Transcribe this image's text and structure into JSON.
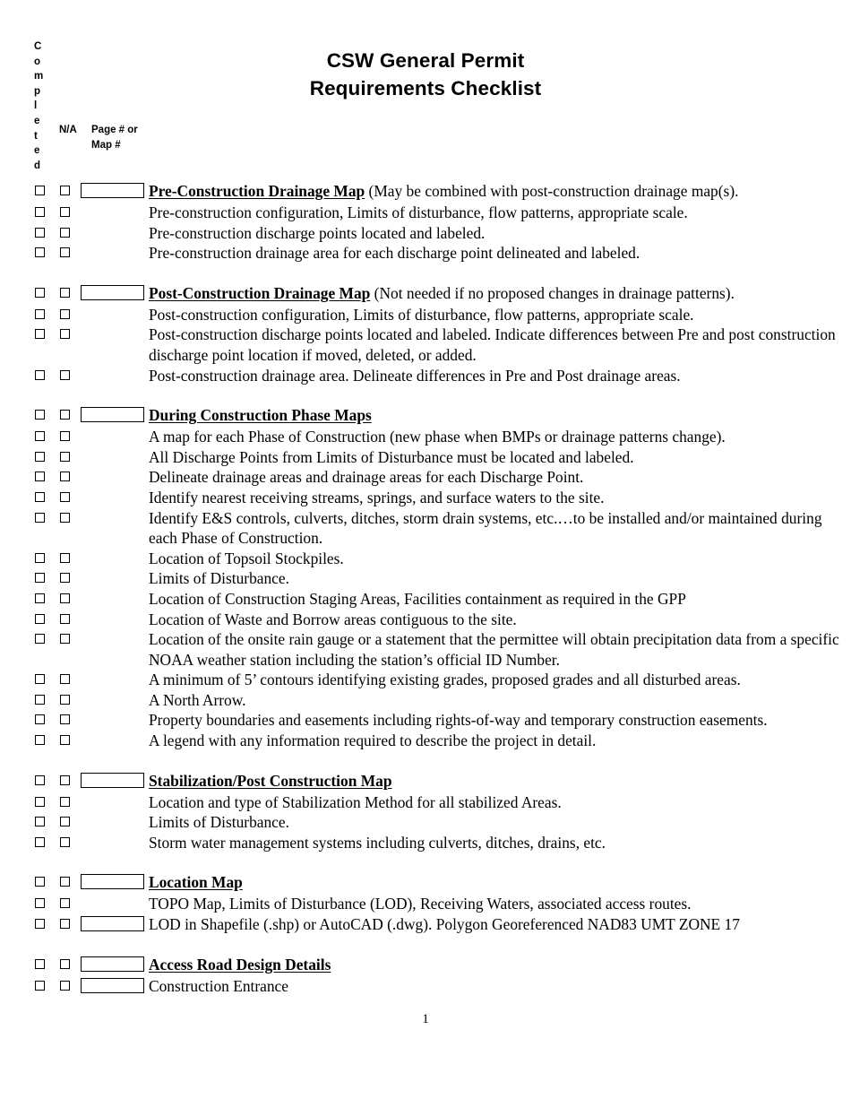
{
  "document": {
    "title_lines": [
      "CSW General Permit",
      "Requirements Checklist"
    ],
    "page_number": "1"
  },
  "column_headers": {
    "completed_letters": [
      "C",
      "o",
      "m",
      "p",
      "l",
      "e",
      "t",
      "e",
      "d"
    ],
    "completed_full": "Completed",
    "na": "N/A",
    "page_ref_line1": "Page # or",
    "page_ref_line2": "Map #"
  },
  "sections": [
    {
      "heading": "Pre-Construction Drainage Map",
      "heading_note": " (May be combined with post-construction drainage map(s).",
      "heading_has_pagebox": true,
      "items": [
        {
          "text": "Pre-construction configuration, Limits of disturbance, flow patterns, appropriate scale.",
          "has_pagebox": false
        },
        {
          "text": "Pre-construction discharge points located and labeled.",
          "has_pagebox": false
        },
        {
          "text": "Pre-construction drainage area for each discharge point delineated and labeled.",
          "has_pagebox": false
        }
      ]
    },
    {
      "heading": "Post-Construction Drainage Map",
      "heading_note": " (Not needed if no proposed changes in drainage patterns).",
      "heading_has_pagebox": true,
      "items": [
        {
          "text": "Post-construction configuration, Limits of disturbance, flow patterns, appropriate scale.",
          "has_pagebox": false
        },
        {
          "text": "Post-construction discharge points located and labeled. Indicate differences between Pre and post construction discharge point location if moved, deleted, or added.",
          "has_pagebox": false
        },
        {
          "text": "Post-construction drainage area. Delineate differences in Pre and Post drainage areas.",
          "has_pagebox": false
        }
      ]
    },
    {
      "heading": "During Construction Phase Maps",
      "heading_note": "",
      "heading_has_pagebox": true,
      "items": [
        {
          "text": "A map for each Phase of Construction (new phase when BMPs or drainage patterns change).",
          "has_pagebox": false
        },
        {
          "text": "All Discharge Points from Limits of Disturbance must be located and labeled.",
          "has_pagebox": false
        },
        {
          "text": "Delineate drainage areas and drainage areas for each Discharge Point.",
          "has_pagebox": false
        },
        {
          "text": "Identify nearest receiving streams, springs, and surface waters to the site.",
          "has_pagebox": false
        },
        {
          "text": "Identify E&S controls, culverts, ditches, storm drain systems, etc.…to be installed and/or maintained during each Phase of Construction.",
          "has_pagebox": false
        },
        {
          "text": "Location of Topsoil Stockpiles.",
          "has_pagebox": false
        },
        {
          "text": "Limits of Disturbance.",
          "has_pagebox": false
        },
        {
          "text": "Location of Construction Staging Areas, Facilities containment as required in the GPP",
          "has_pagebox": false
        },
        {
          "text": "Location of Waste and Borrow areas contiguous to the site.",
          "has_pagebox": false
        },
        {
          "text": "Location of the onsite rain gauge or a statement that the permittee will obtain precipitation data from a specific NOAA weather station including the station’s official ID Number.",
          "has_pagebox": false
        },
        {
          "text": "A minimum of 5’ contours identifying existing grades, proposed grades and all disturbed areas.",
          "has_pagebox": false
        },
        {
          "text": "A North Arrow.",
          "has_pagebox": false
        },
        {
          "text": "Property boundaries and easements including rights-of-way and temporary construction easements.",
          "has_pagebox": false
        },
        {
          "text": "A legend with any information required to describe the project in detail.",
          "has_pagebox": false
        }
      ]
    },
    {
      "heading": "Stabilization/Post Construction Map",
      "heading_note": "",
      "heading_has_pagebox": true,
      "items": [
        {
          "text": "Location and type of Stabilization Method for all stabilized Areas.",
          "has_pagebox": false
        },
        {
          "text": "Limits of Disturbance.",
          "has_pagebox": false
        },
        {
          "text": "Storm water management systems including culverts, ditches, drains, etc.",
          "has_pagebox": false
        }
      ]
    },
    {
      "heading": "Location Map",
      "heading_note": "",
      "heading_has_pagebox": true,
      "items": [
        {
          "text": "TOPO Map, Limits of Disturbance (LOD), Receiving Waters, associated access routes.",
          "has_pagebox": false
        },
        {
          "text": "LOD in Shapefile (.shp) or AutoCAD (.dwg). Polygon Georeferenced NAD83 UMT ZONE 17",
          "has_pagebox": true
        }
      ]
    },
    {
      "heading": "Access Road Design Details",
      "heading_note": "",
      "heading_has_pagebox": true,
      "items": [
        {
          "text": "Construction Entrance",
          "has_pagebox": true
        }
      ]
    }
  ]
}
